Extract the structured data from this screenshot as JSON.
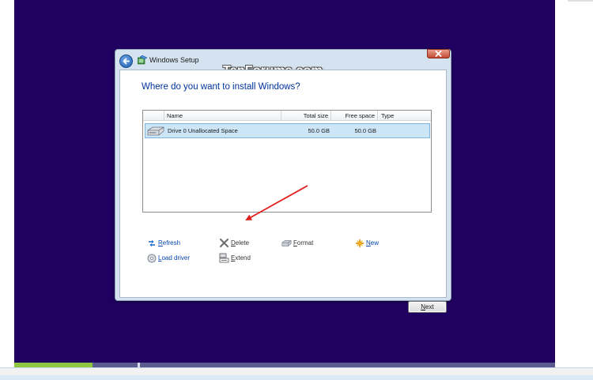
{
  "window": {
    "title": "Windows Setup",
    "watermark": "TenForums.com"
  },
  "page": {
    "heading": "Where do you want to install Windows?"
  },
  "table": {
    "columns": [
      "Name",
      "Total size",
      "Free space",
      "Type"
    ],
    "rows": [
      {
        "name": "Drive 0 Unallocated Space",
        "total_size": "50.0 GB",
        "free_space": "50.0 GB",
        "type": "",
        "icon": "hard-drive-icon",
        "selected": true
      }
    ]
  },
  "actions": {
    "refresh": {
      "accesskey": "R",
      "rest": "efresh",
      "icon": "refresh-icon",
      "enabled": true
    },
    "delete": {
      "accesskey": "D",
      "rest": "elete",
      "icon": "delete-x-icon",
      "enabled": true
    },
    "format": {
      "accesskey": "F",
      "rest": "ormat",
      "icon": "format-drive-icon",
      "enabled": true
    },
    "new": {
      "accesskey": "N",
      "rest": "ew",
      "icon": "new-star-icon",
      "enabled": true
    },
    "load_driver": {
      "accesskey": "L",
      "rest": "oad driver",
      "icon": "load-driver-icon",
      "enabled": true
    },
    "extend": {
      "accesskey": "E",
      "rest": "xtend",
      "icon": "extend-drive-icon",
      "enabled": true
    }
  },
  "buttons": {
    "next_accesskey": "N",
    "next_rest": "ext"
  },
  "progress": {
    "fraction": 0.145
  },
  "colors": {
    "setup_background": "#200060",
    "progress_fill": "#8ec63f",
    "heading": "#003399",
    "selection": "#cde6f7",
    "annotation_arrow": "#e02020"
  }
}
